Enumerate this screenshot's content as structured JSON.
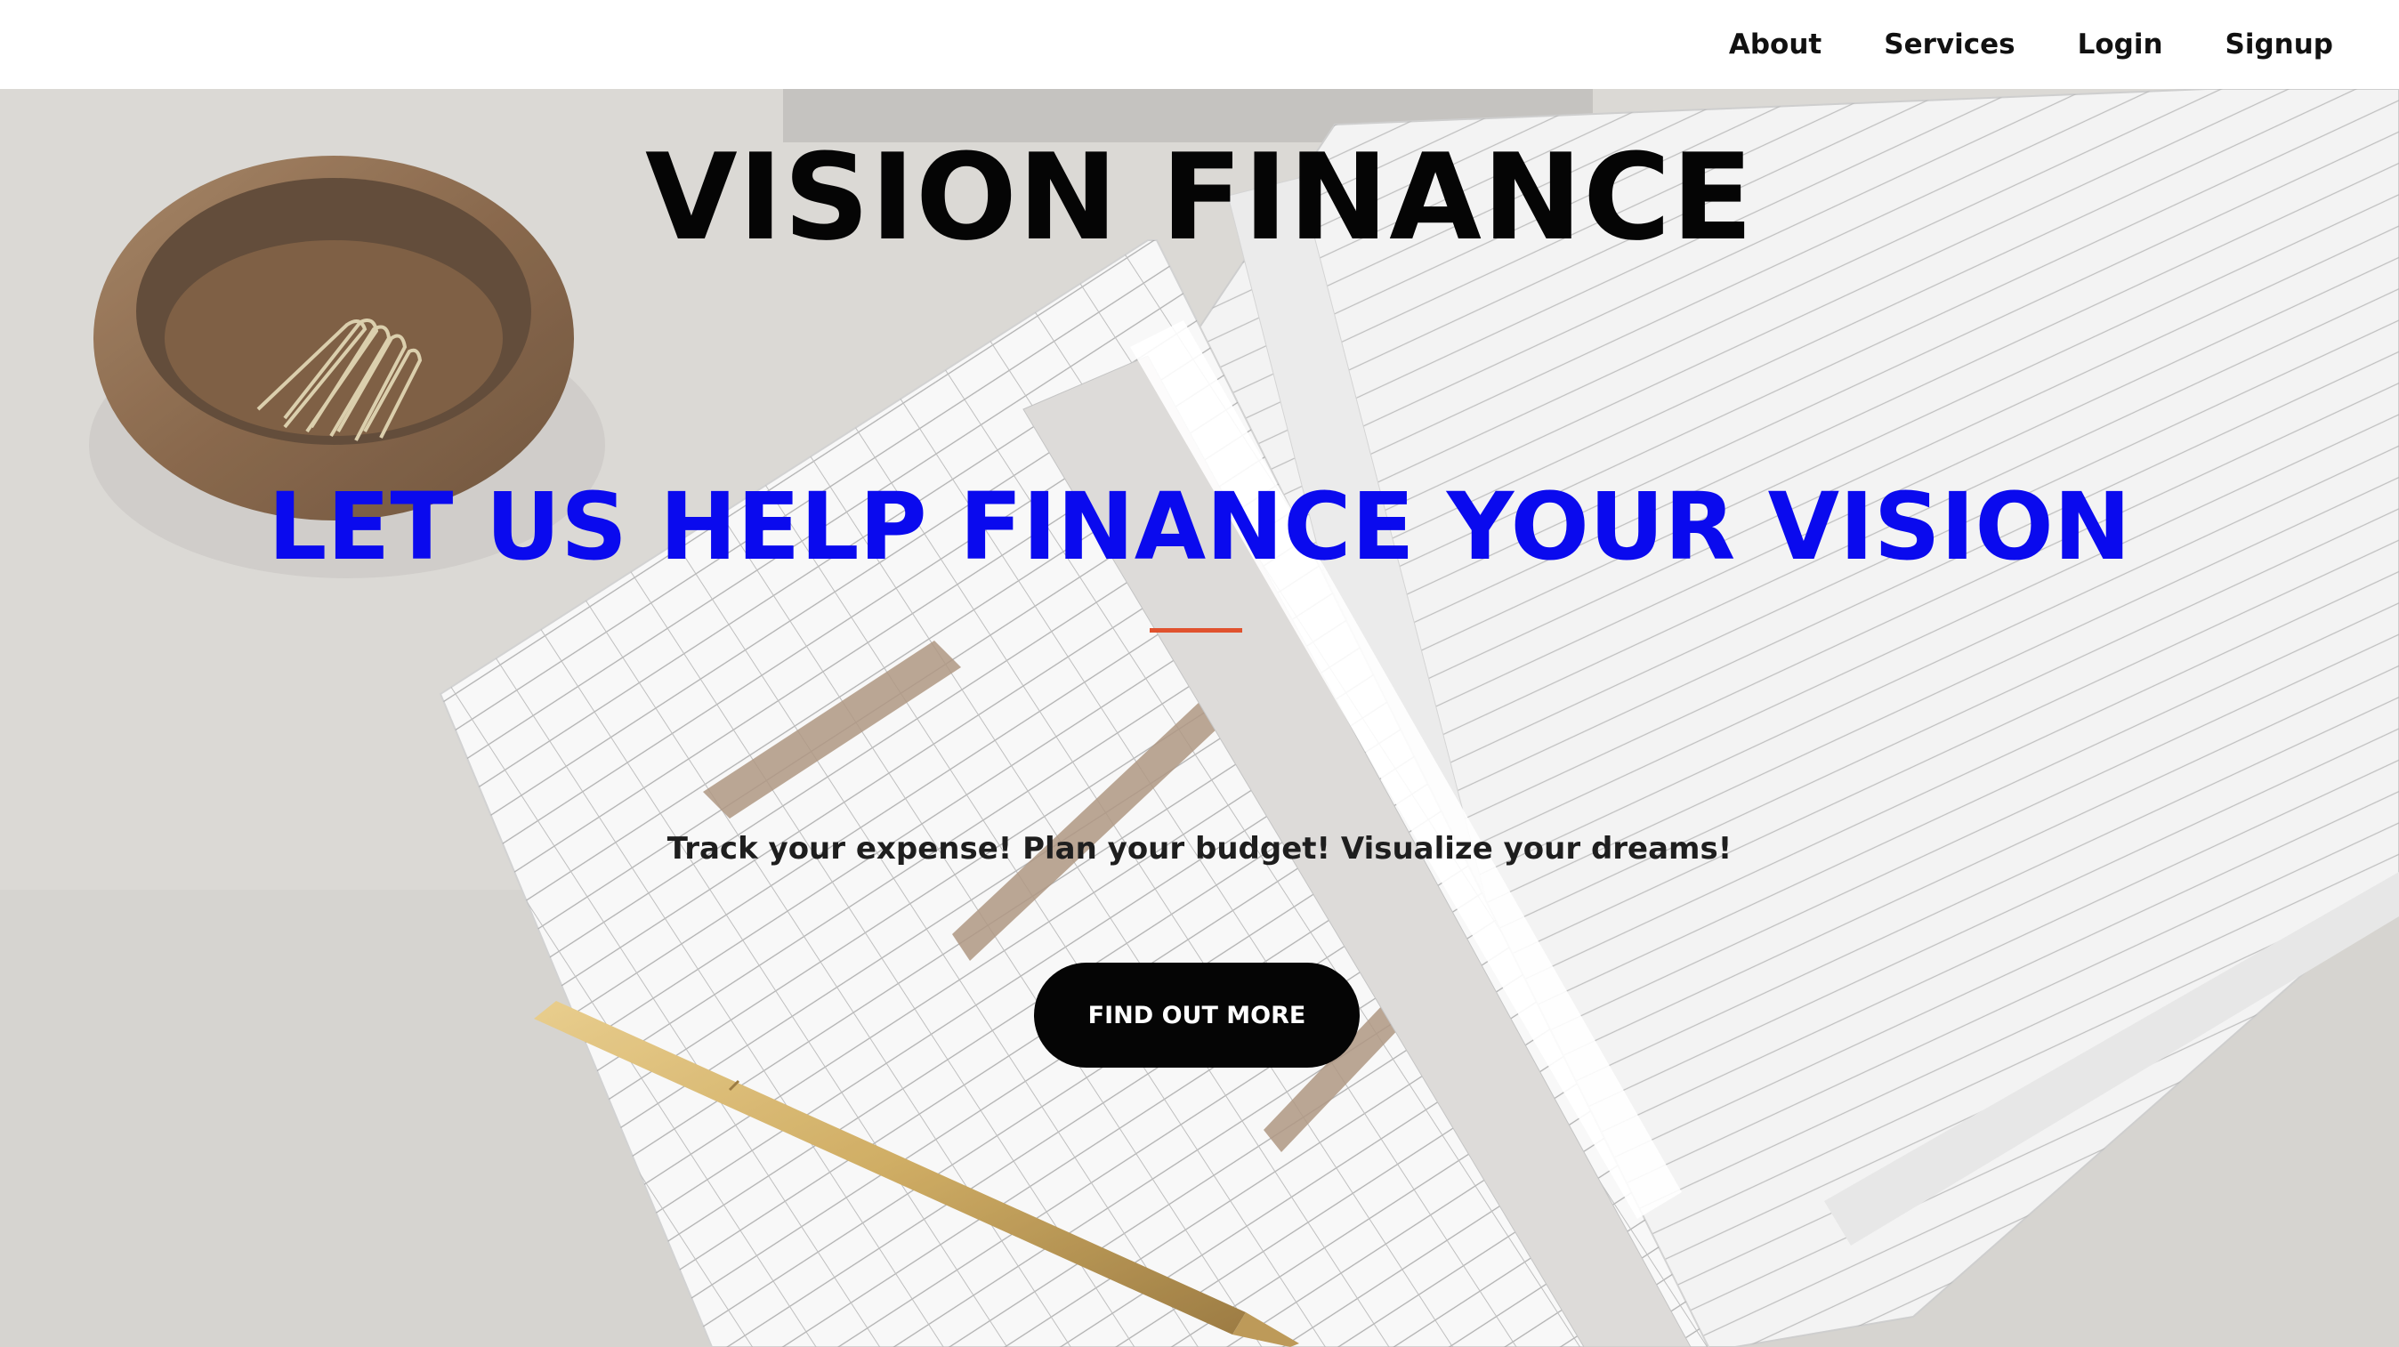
{
  "nav": {
    "items": [
      {
        "label": "About"
      },
      {
        "label": "Services"
      },
      {
        "label": "Login"
      },
      {
        "label": "Signup"
      }
    ]
  },
  "hero": {
    "title": "VISION FINANCE",
    "tagline": "LET US HELP FINANCE YOUR VISION",
    "subtitle": "Track your expense! Plan your budget! Visualize your dreams!",
    "cta_label": "FIND OUT MORE",
    "image_icons": [
      "wooden-bowl-icon",
      "paperclip-icon",
      "gold-pen-icon",
      "budget-sheet-icon",
      "habit-tracker-notebook-icon"
    ]
  },
  "colors": {
    "tagline": "#0a0aee",
    "accent": "#e0522e",
    "cta_background": "#050505",
    "nav_background": "#ffffff"
  }
}
